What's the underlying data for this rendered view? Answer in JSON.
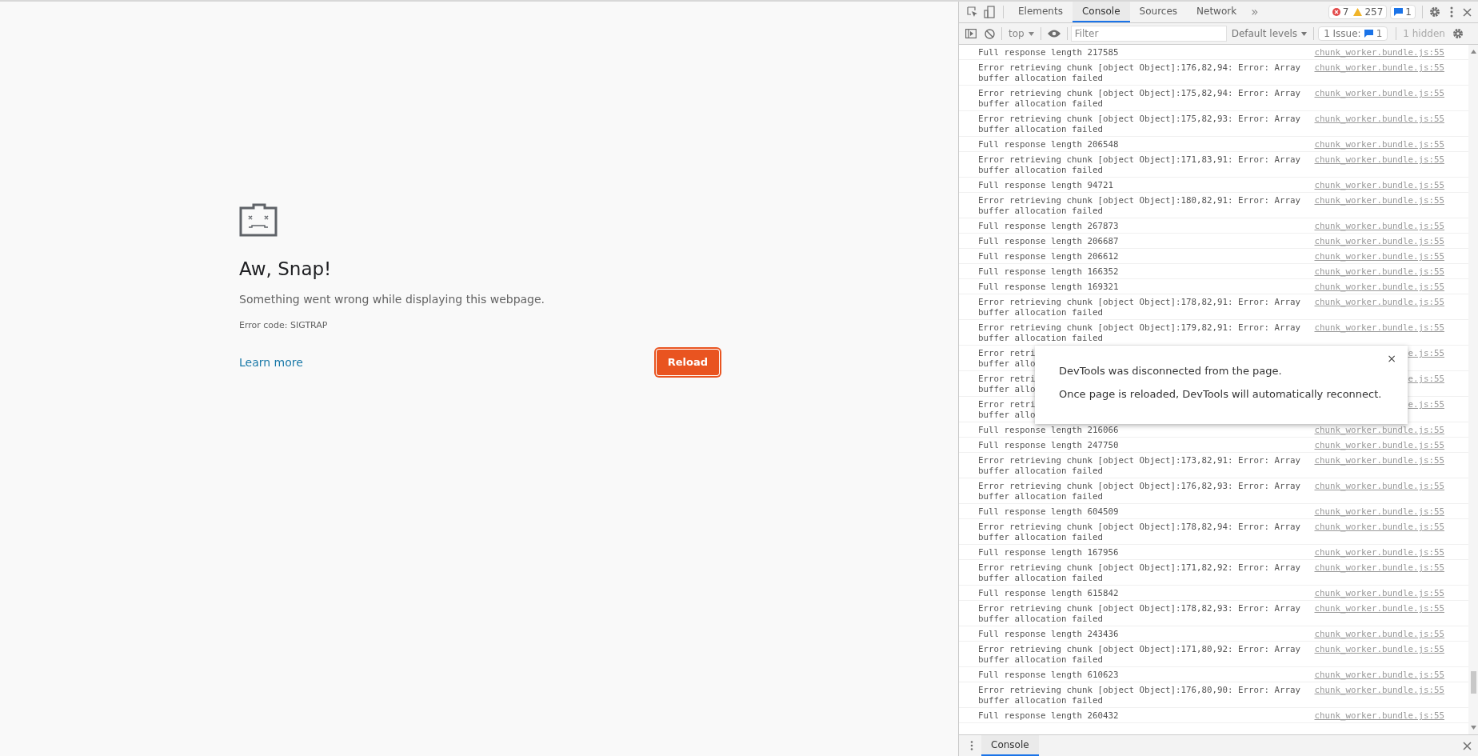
{
  "page": {
    "title": "Aw, Snap!",
    "message": "Something went wrong while displaying this webpage.",
    "error_code": "Error code: SIGTRAP",
    "learn_more": "Learn more",
    "reload": "Reload"
  },
  "devtools": {
    "tabs": [
      {
        "label": "Elements",
        "selected": false
      },
      {
        "label": "Console",
        "selected": true
      },
      {
        "label": "Sources",
        "selected": false
      },
      {
        "label": "Network",
        "selected": false
      }
    ],
    "more": "»",
    "errors": "7",
    "warnings": "257",
    "messages": "1",
    "context": "top",
    "filter_placeholder": "Filter",
    "levels": "Default levels",
    "issues_label": "1 Issue:",
    "issues_count": "1",
    "hidden": "1 hidden",
    "rows": [
      {
        "lines": [
          "Full response length 217585"
        ],
        "source": "chunk_worker.bundle.js:55"
      },
      {
        "lines": [
          "Error retrieving chunk [object Object]:176,82,94: Error: Array",
          "buffer allocation failed"
        ],
        "source": "chunk_worker.bundle.js:55"
      },
      {
        "lines": [
          "Error retrieving chunk [object Object]:175,82,94: Error: Array",
          "buffer allocation failed"
        ],
        "source": "chunk_worker.bundle.js:55"
      },
      {
        "lines": [
          "Error retrieving chunk [object Object]:175,82,93: Error: Array",
          "buffer allocation failed"
        ],
        "source": "chunk_worker.bundle.js:55"
      },
      {
        "lines": [
          "Full response length 206548"
        ],
        "source": "chunk_worker.bundle.js:55"
      },
      {
        "lines": [
          "Error retrieving chunk [object Object]:171,83,91: Error: Array",
          "buffer allocation failed"
        ],
        "source": "chunk_worker.bundle.js:55"
      },
      {
        "lines": [
          "Full response length 94721"
        ],
        "source": "chunk_worker.bundle.js:55"
      },
      {
        "lines": [
          "Error retrieving chunk [object Object]:180,82,91: Error: Array",
          "buffer allocation failed"
        ],
        "source": "chunk_worker.bundle.js:55"
      },
      {
        "lines": [
          "Full response length 267873"
        ],
        "source": "chunk_worker.bundle.js:55"
      },
      {
        "lines": [
          "Full response length 206687"
        ],
        "source": "chunk_worker.bundle.js:55"
      },
      {
        "lines": [
          "Full response length 206612"
        ],
        "source": "chunk_worker.bundle.js:55"
      },
      {
        "lines": [
          "Full response length 166352"
        ],
        "source": "chunk_worker.bundle.js:55"
      },
      {
        "lines": [
          "Full response length 169321"
        ],
        "source": "chunk_worker.bundle.js:55"
      },
      {
        "lines": [
          "Error retrieving chunk [object Object]:178,82,91: Error: Array",
          "buffer allocation failed"
        ],
        "source": "chunk_worker.bundle.js:55"
      },
      {
        "lines": [
          "Error retrieving chunk [object Object]:179,82,91: Error: Array",
          "buffer allocation failed"
        ],
        "source": "chunk_worker.bundle.js:55"
      },
      {
        "lines": [
          "Error retri",
          "buffer allo"
        ],
        "source": "e.js:55"
      },
      {
        "lines": [
          "Error retri",
          "buffer allo"
        ],
        "source": "e.js:55"
      },
      {
        "lines": [
          "Error retri",
          "buffer allo"
        ],
        "source": "e.js:55"
      },
      {
        "lines": [
          "Full response length 216066"
        ],
        "source": "chunk_worker.bundle.js:55"
      },
      {
        "lines": [
          "Full response length 247750"
        ],
        "source": "chunk_worker.bundle.js:55"
      },
      {
        "lines": [
          "Error retrieving chunk [object Object]:173,82,91: Error: Array",
          "buffer allocation failed"
        ],
        "source": "chunk_worker.bundle.js:55"
      },
      {
        "lines": [
          "Error retrieving chunk [object Object]:176,82,93: Error: Array",
          "buffer allocation failed"
        ],
        "source": "chunk_worker.bundle.js:55"
      },
      {
        "lines": [
          "Full response length 604509"
        ],
        "source": "chunk_worker.bundle.js:55"
      },
      {
        "lines": [
          "Error retrieving chunk [object Object]:178,82,94: Error: Array",
          "buffer allocation failed"
        ],
        "source": "chunk_worker.bundle.js:55"
      },
      {
        "lines": [
          "Full response length 167956"
        ],
        "source": "chunk_worker.bundle.js:55"
      },
      {
        "lines": [
          "Error retrieving chunk [object Object]:171,82,92: Error: Array",
          "buffer allocation failed"
        ],
        "source": "chunk_worker.bundle.js:55"
      },
      {
        "lines": [
          "Full response length 615842"
        ],
        "source": "chunk_worker.bundle.js:55"
      },
      {
        "lines": [
          "Error retrieving chunk [object Object]:178,82,93: Error: Array",
          "buffer allocation failed"
        ],
        "source": "chunk_worker.bundle.js:55"
      },
      {
        "lines": [
          "Full response length 243436"
        ],
        "source": "chunk_worker.bundle.js:55"
      },
      {
        "lines": [
          "Error retrieving chunk [object Object]:171,80,92: Error: Array",
          "buffer allocation failed"
        ],
        "source": "chunk_worker.bundle.js:55"
      },
      {
        "lines": [
          "Full response length 610623"
        ],
        "source": "chunk_worker.bundle.js:55"
      },
      {
        "lines": [
          "Error retrieving chunk [object Object]:176,80,90: Error: Array",
          "buffer allocation failed"
        ],
        "source": "chunk_worker.bundle.js:55"
      },
      {
        "lines": [
          "Full response length 260432"
        ],
        "source": "chunk_worker.bundle.js:55"
      }
    ],
    "dialog": {
      "close": "×",
      "lines": [
        "DevTools was disconnected from the page.",
        "Once page is reloaded, DevTools will automatically reconnect."
      ]
    },
    "drawer_tabs": [
      {
        "label": "Console",
        "selected": true
      }
    ]
  }
}
